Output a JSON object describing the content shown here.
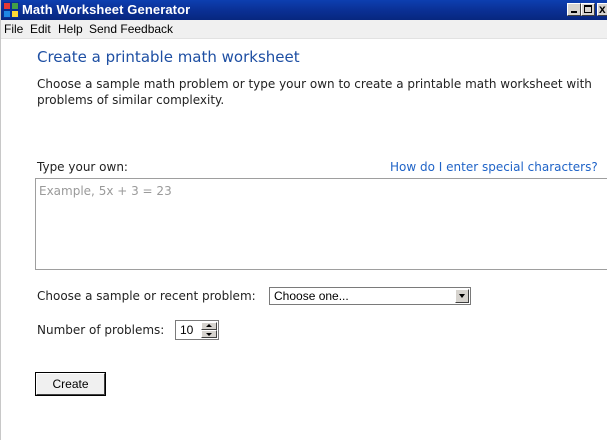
{
  "window": {
    "title": "Math Worksheet Generator",
    "controls": {
      "minimize_icon": "minimize-icon",
      "maximize_icon": "maximize-icon",
      "close_icon": "close-icon",
      "close_glyph": "x"
    }
  },
  "menu": [
    "File",
    "Edit",
    "Help",
    "Send Feedback"
  ],
  "main": {
    "heading": "Create a printable math worksheet",
    "description": "Choose a sample math problem or type your own to create a printable math worksheet with problems of similar complexity.",
    "type_own_label": "Type your own:",
    "help_link": "How do I enter special characters?",
    "problem_input": {
      "value": "",
      "placeholder": "Example, 5x + 3 = 23"
    },
    "sample_label": "Choose a sample or recent problem:",
    "sample_select": {
      "selected": "Choose one..."
    },
    "count_label": "Number of problems:",
    "count_value": "10",
    "create_button": "Create"
  },
  "colors": {
    "titlebar": "#0a2f93",
    "heading": "#1e4fa3",
    "link": "#1f63c7"
  }
}
